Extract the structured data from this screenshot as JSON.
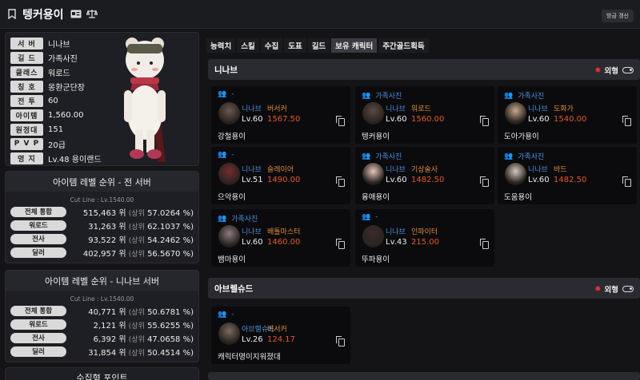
{
  "header": {
    "title": "텡커용이",
    "refresh": "방금 갱신",
    "left_icon": "bookmark-icon",
    "id_icon": "id-card-icon",
    "scale_icon": "balance-icon"
  },
  "profile": {
    "rows": [
      {
        "label": "서 버",
        "value": "니나브"
      },
      {
        "label": "길 드",
        "value": "가족사진"
      },
      {
        "label": "클래스",
        "value": "워로드"
      },
      {
        "label": "칭 호",
        "value": "몽환군단장"
      },
      {
        "label": "전 투",
        "value": "60"
      },
      {
        "label": "아이템",
        "value": "1,560.00"
      },
      {
        "label": "원정대",
        "value": "151"
      },
      {
        "label": "P V P",
        "value": "20급"
      },
      {
        "label": "영 지",
        "value": "Lv.48 용이랜드"
      }
    ]
  },
  "rank_all": {
    "title": "아이템 레벨 순위 - 전 서버",
    "cut": "Cut Line : Lv.1540.00",
    "rows": [
      {
        "label": "전체 통합",
        "value": "515,463 위",
        "sub": "(상위",
        "pct": "57.0264 %)"
      },
      {
        "label": "워로드",
        "value": "31,263 위",
        "sub": "(상위",
        "pct": "62.1037 %)"
      },
      {
        "label": "전사",
        "value": "93,522 위",
        "sub": "(상위",
        "pct": "54.2462 %)"
      },
      {
        "label": "딜러",
        "value": "402,957 위",
        "sub": "(상위",
        "pct": "56.5670 %)"
      }
    ]
  },
  "rank_server": {
    "title": "아이템 레벨 순위 - 니나브 서버",
    "cut": "Cut Line : Lv.1540.00",
    "rows": [
      {
        "label": "전체 통합",
        "value": "40,771 위",
        "sub": "(상위",
        "pct": "50.6781 %)"
      },
      {
        "label": "워로드",
        "value": "2,121 위",
        "sub": "(상위",
        "pct": "55.6255 %)"
      },
      {
        "label": "전사",
        "value": "6,392 위",
        "sub": "(상위",
        "pct": "47.0658 %)"
      },
      {
        "label": "딜러",
        "value": "31,854 위",
        "sub": "(상위",
        "pct": "50.4514 %)"
      }
    ]
  },
  "bottom_title": "수집형 포인트",
  "tabs": [
    "능력치",
    "스킬",
    "수집",
    "도표",
    "길드",
    "보유 캐릭터",
    "주간골드획득"
  ],
  "section1": {
    "title": "니나브",
    "outfit": "외형"
  },
  "section2": {
    "title": "아브렐슈드",
    "outfit": "외형"
  },
  "cards": [
    {
      "guild": "-",
      "server": "니나브",
      "cls": "버서커",
      "lv": "Lv.60",
      "il": "1567.50",
      "nick": "강철용이"
    },
    {
      "guild": "가족사진",
      "server": "니나브",
      "cls": "워로드",
      "lv": "Lv.60",
      "il": "1560.00",
      "nick": "텡커용이"
    },
    {
      "guild": "가족사진",
      "server": "니나브",
      "cls": "도화가",
      "lv": "Lv.60",
      "il": "1540.00",
      "nick": "도아가용이"
    },
    {
      "guild": "-",
      "server": "니나브",
      "cls": "슬레이어",
      "lv": "Lv.51",
      "il": "1490.00",
      "nick": "으악용이"
    },
    {
      "guild": "가족사진",
      "server": "니나브",
      "cls": "기상술사",
      "lv": "Lv.60",
      "il": "1482.50",
      "nick": "융애용이"
    },
    {
      "guild": "가족사진",
      "server": "니나브",
      "cls": "바드",
      "lv": "Lv.60",
      "il": "1482.50",
      "nick": "도움용이"
    },
    {
      "guild": "가족사진",
      "server": "니나브",
      "cls": "배틀마스터",
      "lv": "Lv.60",
      "il": "1460.00",
      "nick": "뱀마용이"
    },
    {
      "guild": "-",
      "server": "니나브",
      "cls": "인파이터",
      "lv": "Lv.43",
      "il": "215.00",
      "nick": "뚜파용이"
    },
    {
      "guild": "-",
      "server": "아브렐슈드",
      "cls": "버서커",
      "lv": "Lv.26",
      "il": "124.17",
      "nick": "캐릭터명이지워졌대"
    }
  ]
}
